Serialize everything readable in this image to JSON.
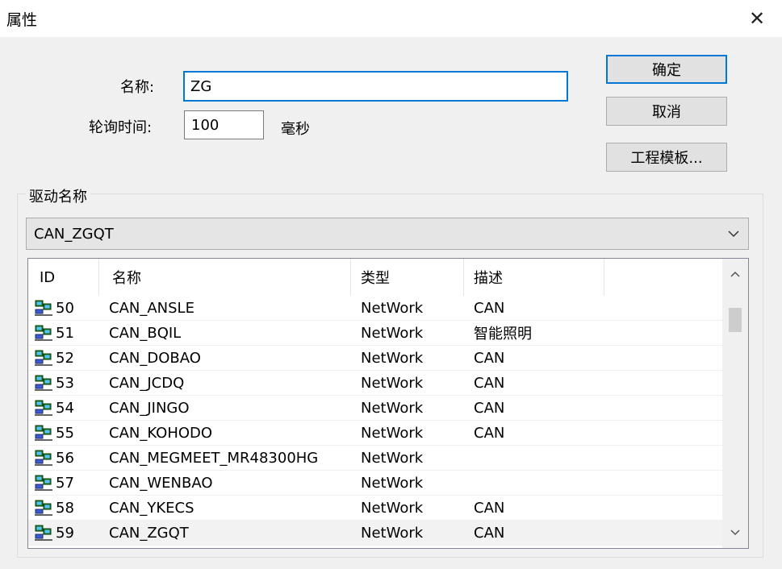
{
  "window": {
    "title": "属性",
    "close_glyph": "✕"
  },
  "form": {
    "name_label": "名称:",
    "name_value": "ZG",
    "poll_label": "轮询时间:",
    "poll_value": "100",
    "poll_unit": "毫秒"
  },
  "buttons": {
    "ok": "确定",
    "cancel": "取消",
    "template": "工程模板..."
  },
  "driver_group": {
    "label": "驱动名称",
    "selected": "CAN_ZGQT",
    "columns": [
      "ID",
      "名称",
      "类型",
      "描述"
    ],
    "rows": [
      {
        "id": "50",
        "name": "CAN_ANSLE",
        "type": "NetWork",
        "desc": "CAN"
      },
      {
        "id": "51",
        "name": "CAN_BQIL",
        "type": "NetWork",
        "desc": "智能照明"
      },
      {
        "id": "52",
        "name": "CAN_DOBAO",
        "type": "NetWork",
        "desc": "CAN"
      },
      {
        "id": "53",
        "name": "CAN_JCDQ",
        "type": "NetWork",
        "desc": "CAN"
      },
      {
        "id": "54",
        "name": "CAN_JINGO",
        "type": "NetWork",
        "desc": "CAN"
      },
      {
        "id": "55",
        "name": "CAN_KOHODO",
        "type": "NetWork",
        "desc": "CAN"
      },
      {
        "id": "56",
        "name": "CAN_MEGMEET_MR48300HG",
        "type": "NetWork",
        "desc": ""
      },
      {
        "id": "57",
        "name": "CAN_WENBAO",
        "type": "NetWork",
        "desc": ""
      },
      {
        "id": "58",
        "name": "CAN_YKECS",
        "type": "NetWork",
        "desc": "CAN"
      },
      {
        "id": "59",
        "name": "CAN_ZGQT",
        "type": "NetWork",
        "desc": "CAN",
        "selected": true
      }
    ],
    "row_icon": "network-computer-icon"
  },
  "colors": {
    "accent": "#0078d7",
    "dialog_bg": "#f0f0f0",
    "selected_row": "#f2f2f2"
  }
}
